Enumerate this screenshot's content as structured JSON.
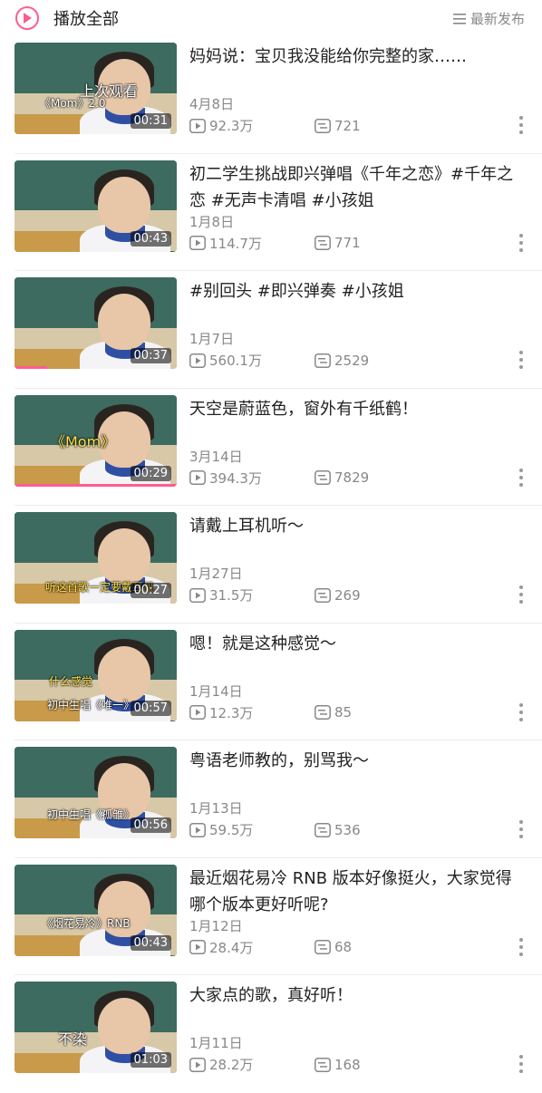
{
  "header": {
    "play_all_label": "播放全部",
    "sort_label": "最新发布",
    "accent_color": "#ff5d8f"
  },
  "videos": [
    {
      "title": "妈妈说：宝贝我没能给你完整的家……",
      "date": "4月8日",
      "plays": "92.3万",
      "danmaku": "721",
      "duration": "00:31",
      "captions": [
        "上次观看",
        "《Mom》2.0"
      ],
      "watched_fraction": 0
    },
    {
      "title": "初二学生挑战即兴弹唱《千年之恋》#千年之恋 #无声卡清唱 #小孩姐",
      "date": "1月8日",
      "plays": "114.7万",
      "danmaku": "771",
      "duration": "00:43",
      "captions": [],
      "watched_fraction": 0
    },
    {
      "title": "#别回头 #即兴弹奏 #小孩姐",
      "date": "1月7日",
      "plays": "560.1万",
      "danmaku": "2529",
      "duration": "00:37",
      "captions": [],
      "watched_fraction": 0.2
    },
    {
      "title": "天空是蔚蓝色，窗外有千纸鹤！",
      "date": "3月14日",
      "plays": "394.3万",
      "danmaku": "7829",
      "duration": "00:29",
      "captions": [
        "《Mom》"
      ],
      "watched_fraction": 1.0
    },
    {
      "title": "请戴上耳机听～",
      "date": "1月27日",
      "plays": "31.5万",
      "danmaku": "269",
      "duration": "00:27",
      "captions": [
        "听这首歌一定要戴耳机"
      ],
      "watched_fraction": 0
    },
    {
      "title": "嗯！就是这种感觉～",
      "date": "1月14日",
      "plays": "12.3万",
      "danmaku": "85",
      "duration": "00:57",
      "captions": [
        "什么感觉",
        "初中生唱《唯一》"
      ],
      "watched_fraction": 0
    },
    {
      "title": "粤语老师教的，别骂我～",
      "date": "1月13日",
      "plays": "59.5万",
      "danmaku": "536",
      "duration": "00:56",
      "captions": [
        "初中生唱《孤雏》"
      ],
      "watched_fraction": 0
    },
    {
      "title": "最近烟花易冷 RNB 版本好像挺火，大家觉得哪个版本更好听呢?",
      "date": "1月12日",
      "plays": "28.4万",
      "danmaku": "68",
      "duration": "00:43",
      "captions": [
        "《烟花易冷》RNB"
      ],
      "watched_fraction": 0
    },
    {
      "title": "大家点的歌，真好听！",
      "date": "1月11日",
      "plays": "28.2万",
      "danmaku": "168",
      "duration": "01:03",
      "captions": [
        "不染"
      ],
      "watched_fraction": 0
    }
  ]
}
